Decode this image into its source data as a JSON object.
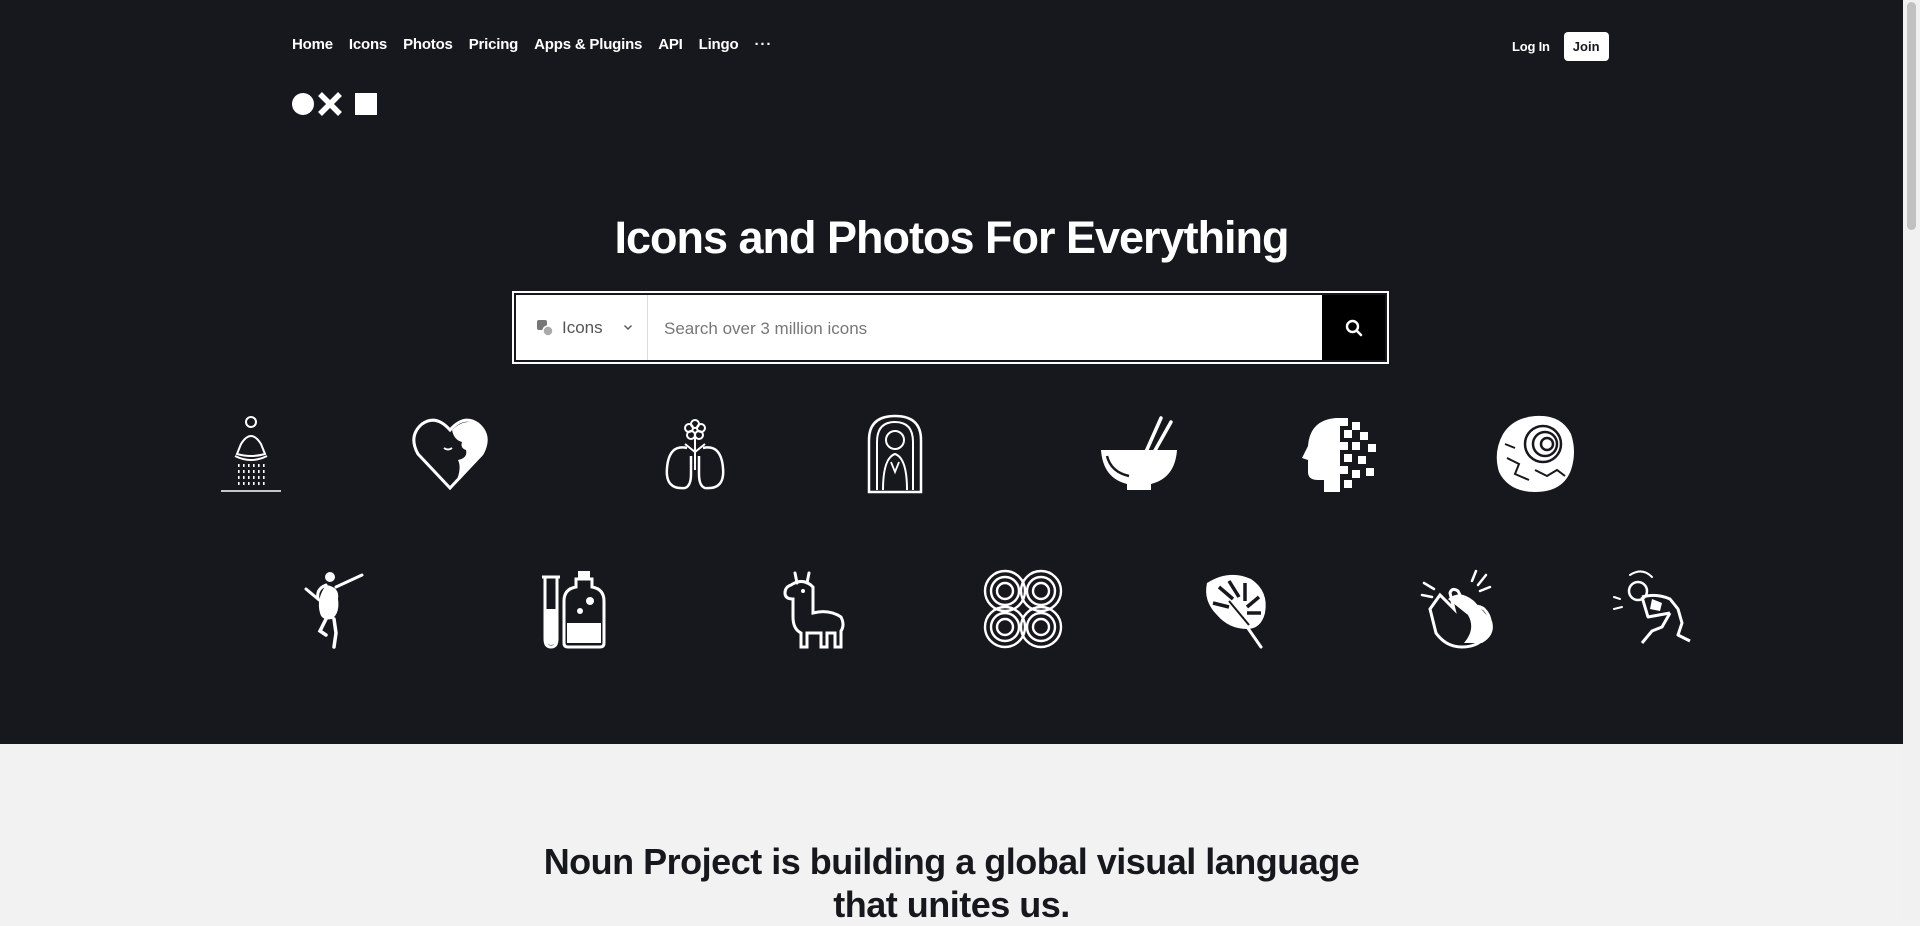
{
  "nav": {
    "items": [
      "Home",
      "Icons",
      "Photos",
      "Pricing",
      "Apps & Plugins",
      "API",
      "Lingo"
    ],
    "more": "···"
  },
  "auth": {
    "login": "Log In",
    "join": "Join"
  },
  "hero": {
    "title": "Icons and Photos For Everything"
  },
  "search": {
    "type_label": "Icons",
    "placeholder": "Search over 3 million icons"
  },
  "icons": [
    "meditating-person-icon",
    "heart-face-icon",
    "flower-lungs-icon",
    "woman-portrait-icon",
    "bowl-chopsticks-icon",
    "pixel-head-icon",
    "ammonite-fossil-icon",
    "dancer-icon",
    "test-tube-bottle-icon",
    "llama-icon",
    "spiral-knot-icon",
    "monstera-leaf-icon",
    "clapping-hands-icon",
    "stretching-person-icon"
  ],
  "mission": {
    "line1": "Noun Project is building a global visual language",
    "line2": "that unites us."
  },
  "colors": {
    "hero_bg": "#17181d",
    "page_bg": "#f1f2f1",
    "accent": "#000000"
  }
}
